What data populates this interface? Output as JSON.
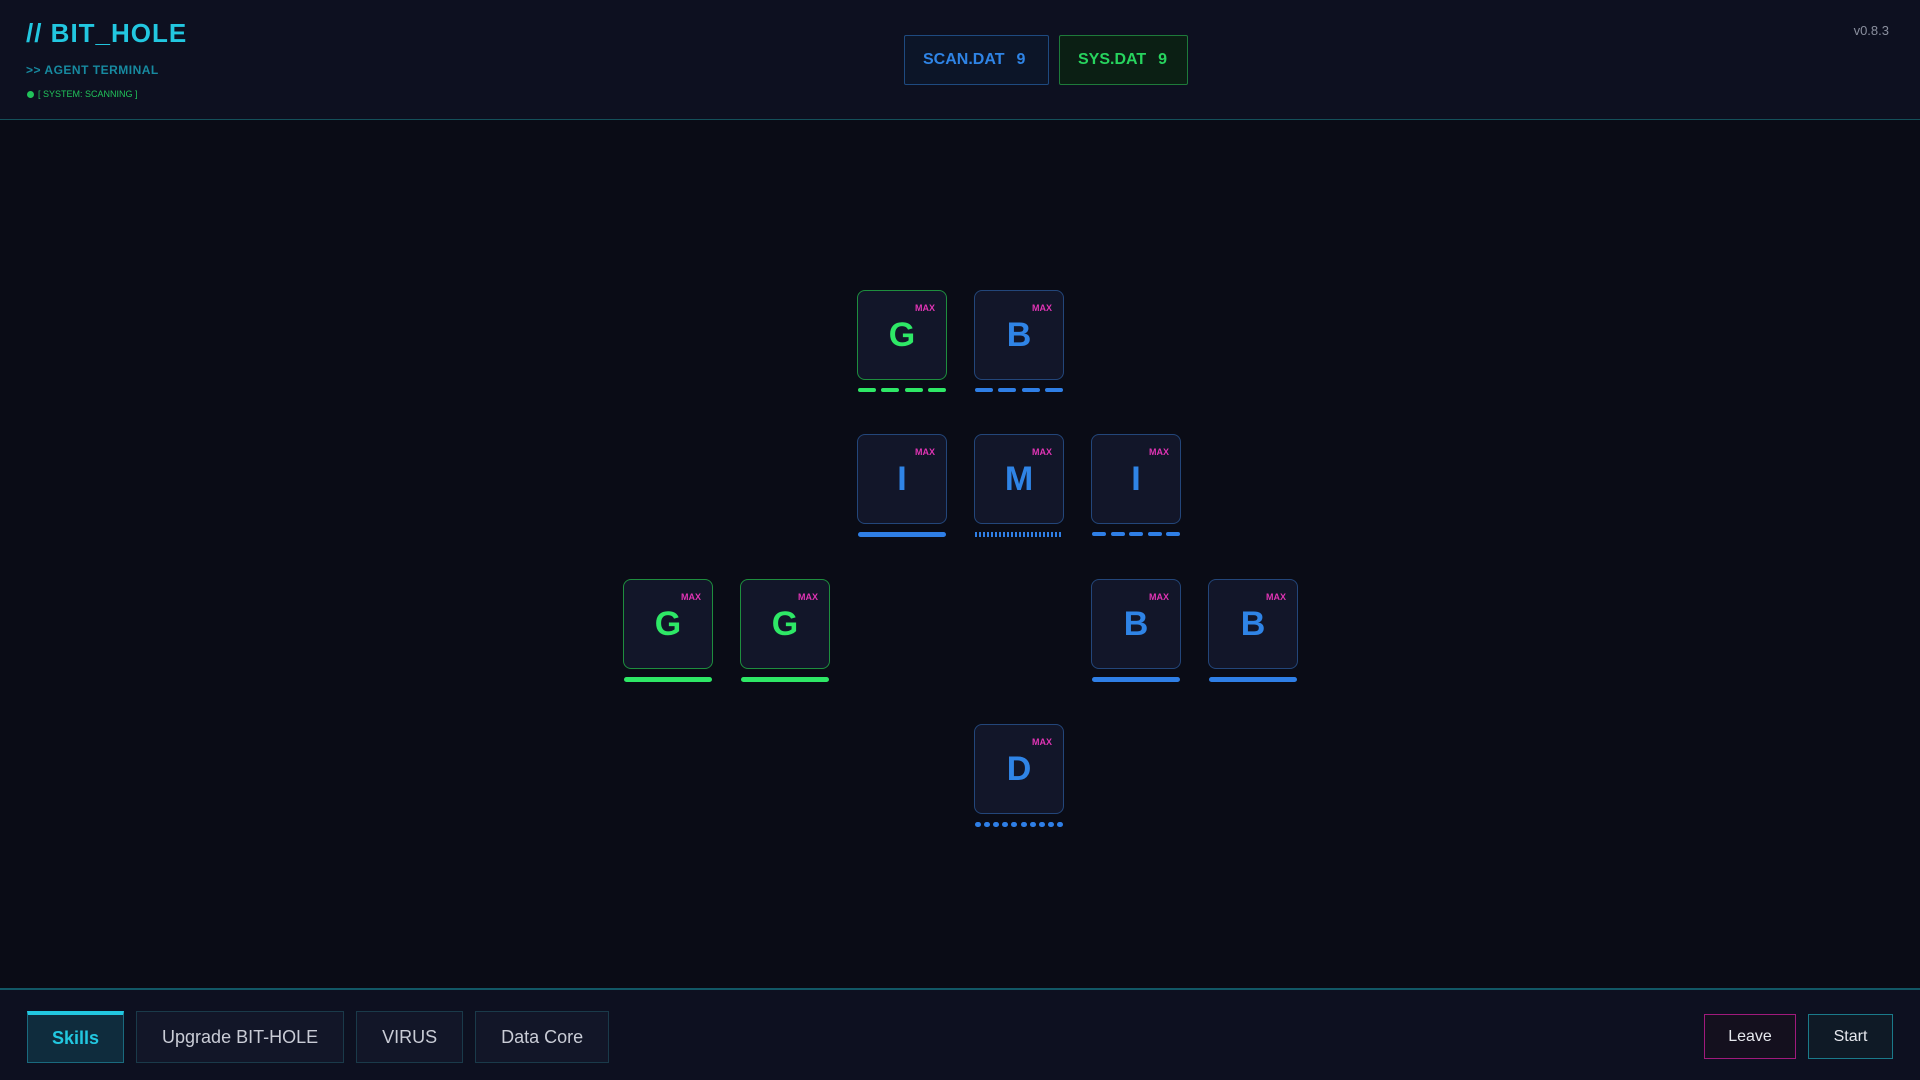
{
  "header": {
    "title": "// BIT_HOLE",
    "subtitle": ">> AGENT TERMINAL",
    "status": "[ SYSTEM: SCANNING ]",
    "version": "v0.8.3",
    "counters": [
      {
        "label": "SCAN.DAT",
        "value": "9",
        "color": "#2f84e6"
      },
      {
        "label": "SYS.DAT",
        "value": "9",
        "color": "#27d45e"
      }
    ]
  },
  "skills": {
    "max_label": "MAX",
    "nodes": [
      {
        "id": "g-top",
        "letter": "G",
        "color": "green",
        "bar": "dashes4"
      },
      {
        "id": "b-top",
        "letter": "B",
        "color": "blue",
        "bar": "dashes4"
      },
      {
        "id": "i-left",
        "letter": "I",
        "color": "blue",
        "bar": "solid"
      },
      {
        "id": "m-center",
        "letter": "M",
        "color": "blue",
        "bar": "ticks"
      },
      {
        "id": "i-right",
        "letter": "I",
        "color": "blue",
        "bar": "dashes5"
      },
      {
        "id": "g-far-left",
        "letter": "G",
        "color": "green",
        "bar": "solid"
      },
      {
        "id": "g-left",
        "letter": "G",
        "color": "green",
        "bar": "solid"
      },
      {
        "id": "b-right",
        "letter": "B",
        "color": "blue",
        "bar": "solid"
      },
      {
        "id": "b-far-right",
        "letter": "B",
        "color": "blue",
        "bar": "solid"
      },
      {
        "id": "d-bottom",
        "letter": "D",
        "color": "blue",
        "bar": "dots"
      }
    ]
  },
  "footer": {
    "tabs": [
      {
        "label": "Skills",
        "active": true
      },
      {
        "label": "Upgrade BIT-HOLE",
        "active": false
      },
      {
        "label": "VIRUS",
        "active": false
      },
      {
        "label": "Data Core",
        "active": false
      }
    ],
    "leave_label": "Leave",
    "start_label": "Start"
  },
  "colors": {
    "accent": "#22c7e0",
    "green": "#2ee866",
    "blue": "#2f84e6",
    "max": "#e034b4",
    "leave_border": "#a01a7c"
  }
}
